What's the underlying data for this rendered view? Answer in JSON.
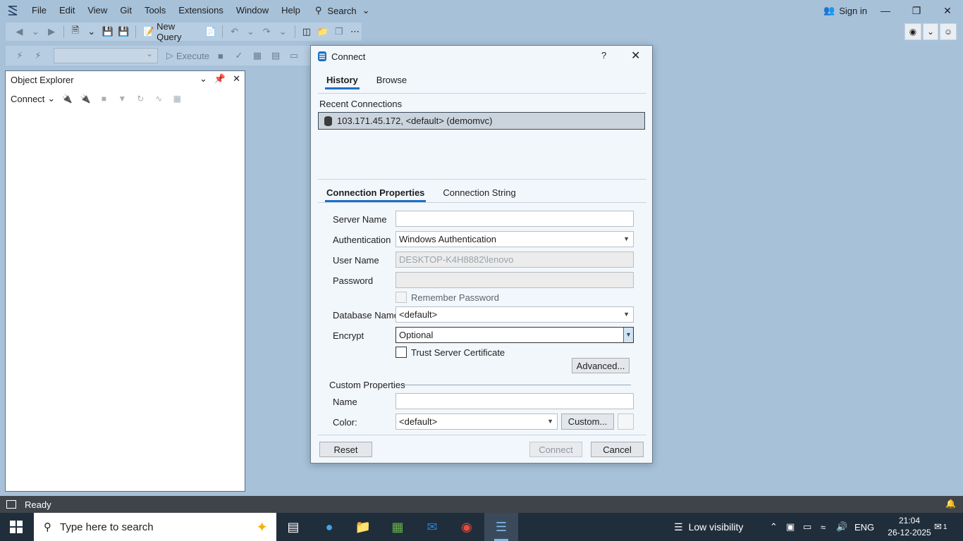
{
  "menubar": {
    "items": [
      "File",
      "Edit",
      "View",
      "Git",
      "Tools",
      "Extensions",
      "Window",
      "Help"
    ],
    "search_label": "Search",
    "signin_label": "Sign in"
  },
  "toolbar": {
    "new_query_label": "New Query",
    "execute_label": "Execute"
  },
  "object_explorer": {
    "title": "Object Explorer",
    "connect_label": "Connect"
  },
  "dialog": {
    "title": "Connect",
    "help": "?",
    "tabs": [
      "History",
      "Browse"
    ],
    "recent_connections_label": "Recent Connections",
    "recent_connection": "103.171.45.172, <default> (demomvc)",
    "prop_tabs": [
      "Connection Properties",
      "Connection String"
    ],
    "server_name_label": "Server Name",
    "server_name_value": "",
    "authentication_label": "Authentication",
    "authentication_value": "Windows Authentication",
    "user_name_label": "User Name",
    "user_name_value": "DESKTOP-K4H8882\\lenovo",
    "password_label": "Password",
    "remember_password_label": "Remember Password",
    "database_name_label": "Database Name",
    "database_name_value": "<default>",
    "encrypt_label": "Encrypt",
    "encrypt_value": "Optional",
    "trust_cert_label": "Trust Server Certificate",
    "advanced_label": "Advanced...",
    "custom_properties_label": "Custom Properties",
    "name_label": "Name",
    "name_value": "",
    "color_label": "Color:",
    "color_value": "<default>",
    "custom_label": "Custom...",
    "reset_label": "Reset",
    "connect_label": "Connect",
    "cancel_label": "Cancel"
  },
  "statusbar": {
    "text": "Ready"
  },
  "taskbar": {
    "search_placeholder": "Type here to search",
    "weather": "Low visibility",
    "language": "ENG",
    "time": "21:04",
    "date": "26-12-2025",
    "notification_count": "1"
  },
  "colors": {
    "chrome_bg": "#a7c1d9",
    "accent": "#1f6fc5",
    "taskbar": "#202e3c"
  }
}
